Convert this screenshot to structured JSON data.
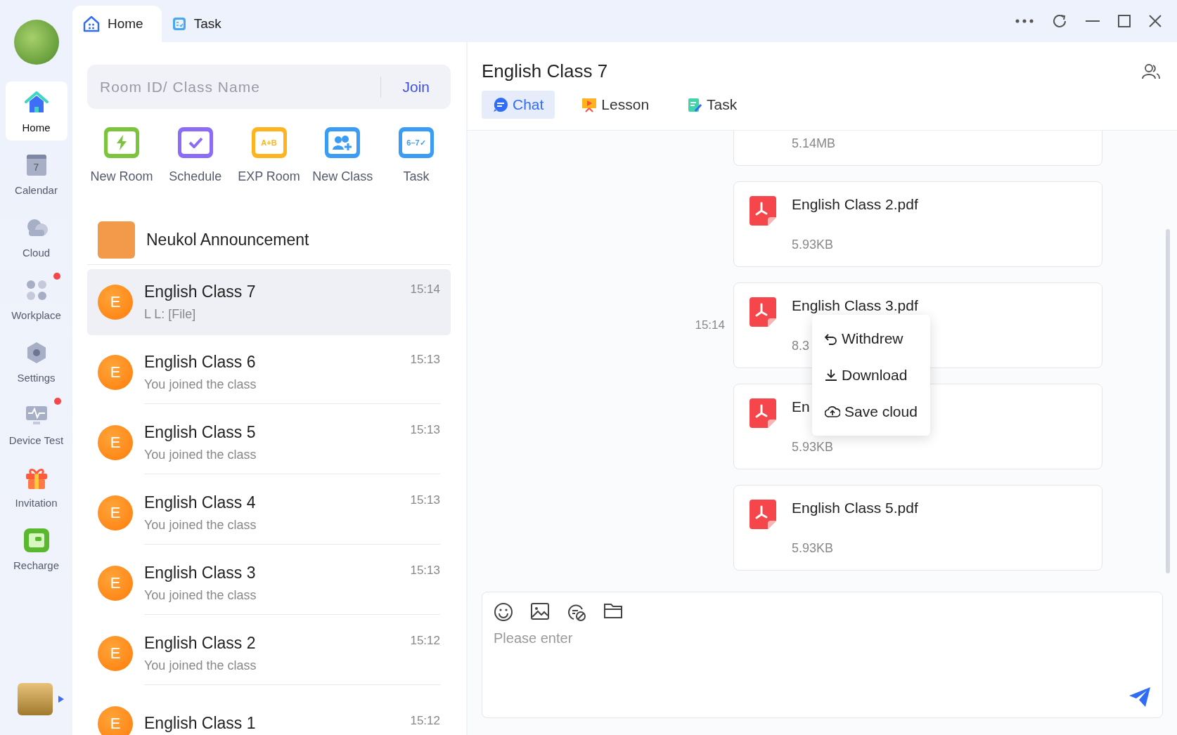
{
  "rail": {
    "items": [
      {
        "label": "Home",
        "kind": "home",
        "selected": true,
        "badge": false
      },
      {
        "label": "Calendar",
        "kind": "calendar",
        "selected": false,
        "badge": false,
        "glyph": "7"
      },
      {
        "label": "Cloud",
        "kind": "cloud",
        "selected": false,
        "badge": false
      },
      {
        "label": "Workplace",
        "kind": "workplace",
        "selected": false,
        "badge": true
      },
      {
        "label": "Settings",
        "kind": "settings",
        "selected": false,
        "badge": false
      },
      {
        "label": "Device Test",
        "kind": "device",
        "selected": false,
        "badge": true
      },
      {
        "label": "Invitation",
        "kind": "gift",
        "selected": false,
        "badge": false
      },
      {
        "label": "Recharge",
        "kind": "wallet",
        "selected": false,
        "badge": false
      }
    ]
  },
  "top_tabs": [
    {
      "label": "Home",
      "kind": "home",
      "selected": true
    },
    {
      "label": "Task",
      "kind": "task",
      "selected": false
    }
  ],
  "search": {
    "placeholder": "Room ID/ Class Name",
    "button": "Join"
  },
  "quick_actions": [
    {
      "label": "New Room",
      "kind": "newroom",
      "color": "#7cc43c"
    },
    {
      "label": "Schedule",
      "kind": "schedule",
      "color": "#8b6cf6"
    },
    {
      "label": "EXP Room",
      "kind": "exp",
      "color": "#ffb41f",
      "glyph": "A+B"
    },
    {
      "label": "New Class",
      "kind": "newclass",
      "color": "#3a9cf5"
    },
    {
      "label": "Task",
      "kind": "task",
      "color": "#3a9cf5",
      "glyph": "6–7✓"
    }
  ],
  "announcement": {
    "title": "Neukol Announcement"
  },
  "conversations": [
    {
      "avatar": "E",
      "name": "English Class 7",
      "preview": "L L: [File]",
      "time": "15:14",
      "selected": true
    },
    {
      "avatar": "E",
      "name": "English Class 6",
      "preview": "You joined the class",
      "time": "15:13",
      "selected": false
    },
    {
      "avatar": "E",
      "name": "English Class 5",
      "preview": "You joined the class",
      "time": "15:13",
      "selected": false
    },
    {
      "avatar": "E",
      "name": "English Class 4",
      "preview": "You joined the class",
      "time": "15:13",
      "selected": false
    },
    {
      "avatar": "E",
      "name": "English Class 3",
      "preview": "You joined the class",
      "time": "15:13",
      "selected": false
    },
    {
      "avatar": "E",
      "name": "English Class 2",
      "preview": "You joined the class",
      "time": "15:12",
      "selected": false
    },
    {
      "avatar": "E",
      "name": "English Class 1",
      "time": "15:12",
      "selected": false
    }
  ],
  "chat": {
    "title": "English Class 7",
    "tabs": [
      {
        "label": "Chat",
        "kind": "chat",
        "selected": true
      },
      {
        "label": "Lesson",
        "kind": "lesson",
        "selected": false
      },
      {
        "label": "Task",
        "kind": "task",
        "selected": false
      }
    ],
    "messages": [
      {
        "size": "5.14MB"
      },
      {
        "name": "English Class 2.pdf",
        "size": "5.93KB"
      },
      {
        "name": "English Class 3.pdf",
        "size": "8.3",
        "time": "15:14",
        "menu": [
          {
            "label": "Withdrew",
            "kind": "undo"
          },
          {
            "label": "Download",
            "kind": "download"
          },
          {
            "label": "Save cloud",
            "kind": "cloud-upload"
          }
        ]
      },
      {
        "name": "En",
        "size": "5.93KB"
      },
      {
        "name": "English Class 5.pdf",
        "size": "5.93KB"
      }
    ],
    "input": {
      "placeholder": "Please enter"
    }
  }
}
